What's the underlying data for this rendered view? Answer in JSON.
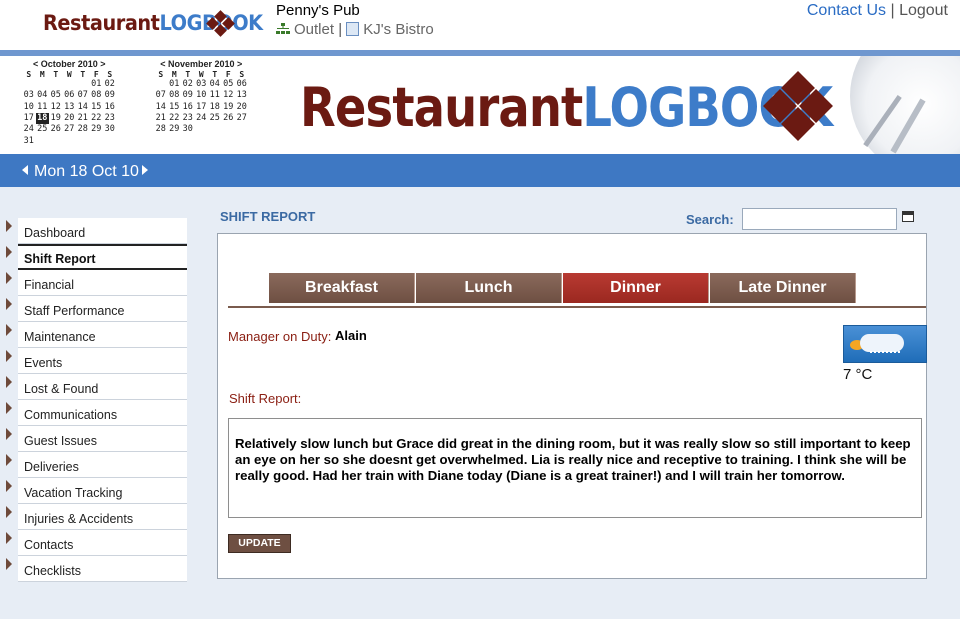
{
  "header": {
    "logo": {
      "part1": "Restaurant",
      "part2": "LOGBOOK"
    },
    "venue_name": "Penny's Pub",
    "outlet_link": "Outlet",
    "separator": "|",
    "bistro_link": "KJ's Bistro",
    "contact_link": "Contact Us",
    "logout_link": "Logout"
  },
  "calendars": [
    {
      "title": "< October 2010 >",
      "weekdays": [
        "S",
        "M",
        "T",
        "W",
        "T",
        "F",
        "S"
      ],
      "weeks": [
        [
          "",
          "",
          "",
          "",
          "",
          "01",
          "02"
        ],
        [
          "03",
          "04",
          "05",
          "06",
          "07",
          "08",
          "09"
        ],
        [
          "10",
          "11",
          "12",
          "13",
          "14",
          "15",
          "16"
        ],
        [
          "17",
          "18",
          "19",
          "20",
          "21",
          "22",
          "23"
        ],
        [
          "24",
          "25",
          "26",
          "27",
          "28",
          "29",
          "30"
        ],
        [
          "31",
          "",
          "",
          "",
          "",
          "",
          ""
        ]
      ],
      "selected": "18"
    },
    {
      "title": "< November 2010 >",
      "weekdays": [
        "S",
        "M",
        "T",
        "W",
        "T",
        "F",
        "S"
      ],
      "weeks": [
        [
          "",
          "01",
          "02",
          "03",
          "04",
          "05",
          "06"
        ],
        [
          "07",
          "08",
          "09",
          "10",
          "11",
          "12",
          "13"
        ],
        [
          "14",
          "15",
          "16",
          "17",
          "18",
          "19",
          "20"
        ],
        [
          "21",
          "22",
          "23",
          "24",
          "25",
          "26",
          "27"
        ],
        [
          "28",
          "29",
          "30",
          "",
          "",
          "",
          ""
        ]
      ],
      "selected": ""
    }
  ],
  "datebar": {
    "date": "Mon 18 Oct 10"
  },
  "sidebar": {
    "items": [
      {
        "label": "Dashboard"
      },
      {
        "label": "Shift Report",
        "active": true
      },
      {
        "label": "Financial"
      },
      {
        "label": "Staff Performance"
      },
      {
        "label": "Maintenance"
      },
      {
        "label": "Events"
      },
      {
        "label": "Lost & Found"
      },
      {
        "label": "Communications"
      },
      {
        "label": "Guest Issues"
      },
      {
        "label": "Deliveries"
      },
      {
        "label": "Vacation Tracking"
      },
      {
        "label": "Injuries & Accidents"
      },
      {
        "label": "Contacts"
      },
      {
        "label": "Checklists"
      }
    ]
  },
  "main": {
    "section_title": "SHIFT REPORT",
    "search_label": "Search:",
    "search_value": "",
    "tabs": [
      {
        "label": "Breakfast"
      },
      {
        "label": "Lunch"
      },
      {
        "label": "Dinner",
        "active": true
      },
      {
        "label": "Late Dinner"
      }
    ],
    "manager_label": "Manager on Duty:",
    "manager_name": "Alain",
    "temperature": "7 °C",
    "shift_report_label": "Shift Report:",
    "report_text": "Relatively slow lunch but Grace did great in the dining room, but it was really slow so still important to keep an eye on her so she doesnt get overwhelmed. Lia is really nice and receptive to training. I think she will be really good. Had her train with Diane today (Diane is a great trainer!) and I will train her tomorrow.",
    "update_button": "UPDATE"
  },
  "colors": {
    "brand_dark": "#6b1a12",
    "brand_blue": "#3d7cc9",
    "tab_active": "#b83a32",
    "tab_default": "#7a5b4d"
  },
  "icons": {
    "weather": "snow-cloud-sun-icon",
    "calendar": "calendar-icon"
  }
}
